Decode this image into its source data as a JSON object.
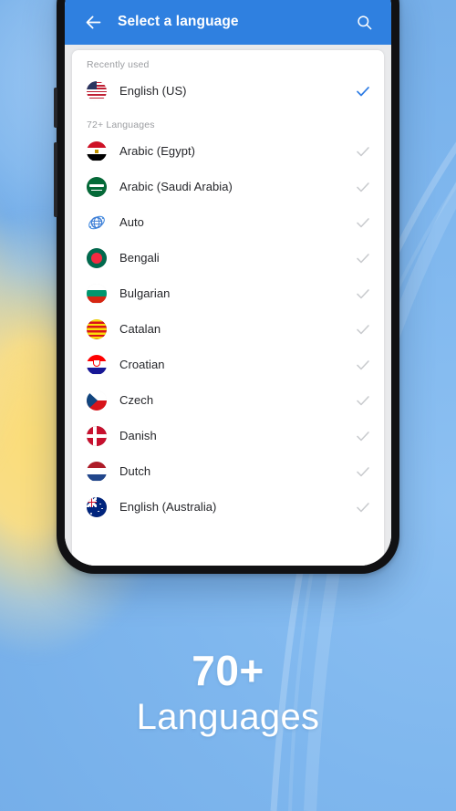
{
  "appbar": {
    "title": "Select a language",
    "back_icon": "arrow-left-icon",
    "search_icon": "search-icon",
    "bg_color": "#2f80e0"
  },
  "sections": [
    {
      "label": "Recently used"
    },
    {
      "label": "72+ Languages"
    }
  ],
  "recently_used": [
    {
      "name": "English (US)",
      "flag": "us",
      "selected": true
    }
  ],
  "languages": [
    {
      "name": "Arabic (Egypt)",
      "flag": "eg",
      "selected": false
    },
    {
      "name": "Arabic (Saudi Arabia)",
      "flag": "sa",
      "selected": false
    },
    {
      "name": "Auto",
      "flag": "auto",
      "selected": false
    },
    {
      "name": "Bengali",
      "flag": "bd",
      "selected": false
    },
    {
      "name": "Bulgarian",
      "flag": "bg",
      "selected": false
    },
    {
      "name": "Catalan",
      "flag": "cat",
      "selected": false
    },
    {
      "name": "Croatian",
      "flag": "hr",
      "selected": false
    },
    {
      "name": "Czech",
      "flag": "cz",
      "selected": false
    },
    {
      "name": "Danish",
      "flag": "dk",
      "selected": false
    },
    {
      "name": "Dutch",
      "flag": "nl",
      "selected": false
    },
    {
      "name": "English (Australia)",
      "flag": "au",
      "selected": false
    }
  ],
  "promo": {
    "headline": "70+",
    "subline": "Languages"
  },
  "colors": {
    "accent": "#2f80e0",
    "check_selected": "#2e7ce4",
    "check_unselected": "#c9cbce",
    "text_primary": "#25262a",
    "text_muted": "#9b9da1",
    "background_blue": "#7fb7ee",
    "background_yellow": "#f8dd86",
    "phone_frame": "#111113"
  }
}
